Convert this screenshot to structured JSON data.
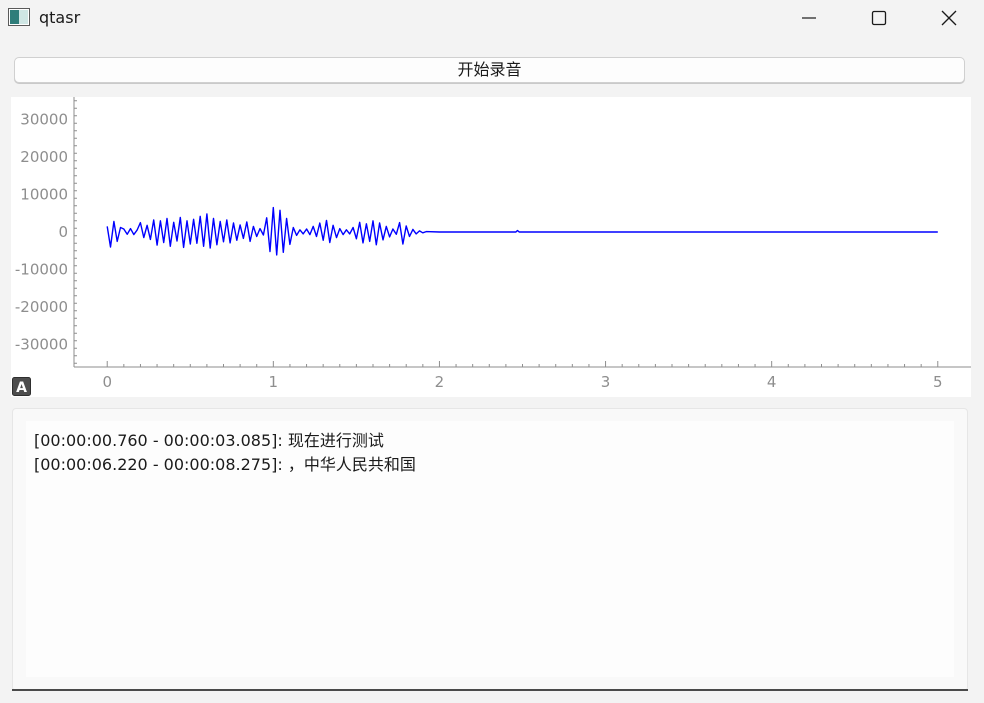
{
  "window": {
    "title": "qtasr"
  },
  "toolbar": {
    "record_label": "开始录音"
  },
  "plot": {
    "badge_label": "A"
  },
  "chart_data": {
    "type": "line",
    "title": "",
    "xlabel": "",
    "ylabel": "",
    "xlim": [
      -0.2,
      5.2
    ],
    "ylim": [
      -36000,
      36000
    ],
    "x_ticks": [
      0,
      1,
      2,
      3,
      4,
      5
    ],
    "y_ticks": [
      30000,
      20000,
      10000,
      0,
      -10000,
      -20000,
      -30000
    ],
    "x_tick_labels": [
      "0",
      "1",
      "2",
      "3",
      "4",
      "5"
    ],
    "y_tick_labels": [
      "30000",
      "20000",
      "10000",
      "0",
      "-10000",
      "-20000",
      "-30000"
    ],
    "series": [
      {
        "color": "#0000ff",
        "x": [
          0.0,
          0.02,
          0.04,
          0.06,
          0.08,
          0.1,
          0.12,
          0.14,
          0.16,
          0.18,
          0.2,
          0.22,
          0.24,
          0.26,
          0.28,
          0.3,
          0.32,
          0.34,
          0.36,
          0.38,
          0.4,
          0.42,
          0.44,
          0.46,
          0.48,
          0.5,
          0.52,
          0.54,
          0.56,
          0.58,
          0.6,
          0.62,
          0.64,
          0.66,
          0.68,
          0.7,
          0.72,
          0.74,
          0.76,
          0.78,
          0.8,
          0.82,
          0.84,
          0.86,
          0.88,
          0.9,
          0.92,
          0.94,
          0.96,
          0.98,
          1.0,
          1.02,
          1.04,
          1.06,
          1.08,
          1.1,
          1.12,
          1.14,
          1.16,
          1.18,
          1.2,
          1.22,
          1.24,
          1.26,
          1.28,
          1.3,
          1.32,
          1.34,
          1.36,
          1.38,
          1.4,
          1.42,
          1.44,
          1.46,
          1.48,
          1.5,
          1.52,
          1.54,
          1.56,
          1.58,
          1.6,
          1.62,
          1.64,
          1.66,
          1.68,
          1.7,
          1.72,
          1.74,
          1.76,
          1.78,
          1.8,
          1.82,
          1.84,
          1.86,
          1.88,
          1.9,
          1.92,
          2.0,
          2.2,
          2.4,
          2.46,
          2.47,
          2.48,
          2.6,
          3.0,
          3.5,
          4.0,
          4.5,
          5.0
        ],
        "y": [
          1500,
          -4000,
          2800,
          -2500,
          1200,
          800,
          -600,
          900,
          -700,
          500,
          2500,
          -1500,
          1800,
          -2000,
          3200,
          -3500,
          3000,
          -2800,
          3600,
          -3800,
          2600,
          -2400,
          3900,
          -4100,
          3000,
          -3200,
          3400,
          -3000,
          4200,
          -3800,
          4800,
          -4300,
          3600,
          -3400,
          2800,
          -2600,
          3200,
          -2900,
          2400,
          -2200,
          1900,
          -1700,
          2700,
          -2500,
          1500,
          -1200,
          900,
          -800,
          3800,
          -5200,
          6500,
          -6100,
          5800,
          -5400,
          3600,
          -3300,
          1200,
          -900,
          600,
          -500,
          800,
          -700,
          1500,
          -1200,
          2400,
          -2200,
          3100,
          -2800,
          1800,
          -1500,
          900,
          -700,
          600,
          -500,
          1200,
          -1800,
          2600,
          -2900,
          2200,
          -2500,
          3000,
          -3400,
          2400,
          -2100,
          1500,
          -1300,
          800,
          -600,
          2500,
          -3200,
          1600,
          -1200,
          700,
          -500,
          300,
          -200,
          100,
          0,
          0,
          0,
          0,
          400,
          0,
          0,
          0,
          0,
          0,
          0,
          0
        ]
      }
    ]
  },
  "results": {
    "line1_time": "[00:00:00.760 - 00:00:03.085]",
    "line1_text": ": 现在进行测试",
    "line2_time": "[00:00:06.220 - 00:00:08.275]",
    "line2_text": ": ，中华人民共和国"
  }
}
